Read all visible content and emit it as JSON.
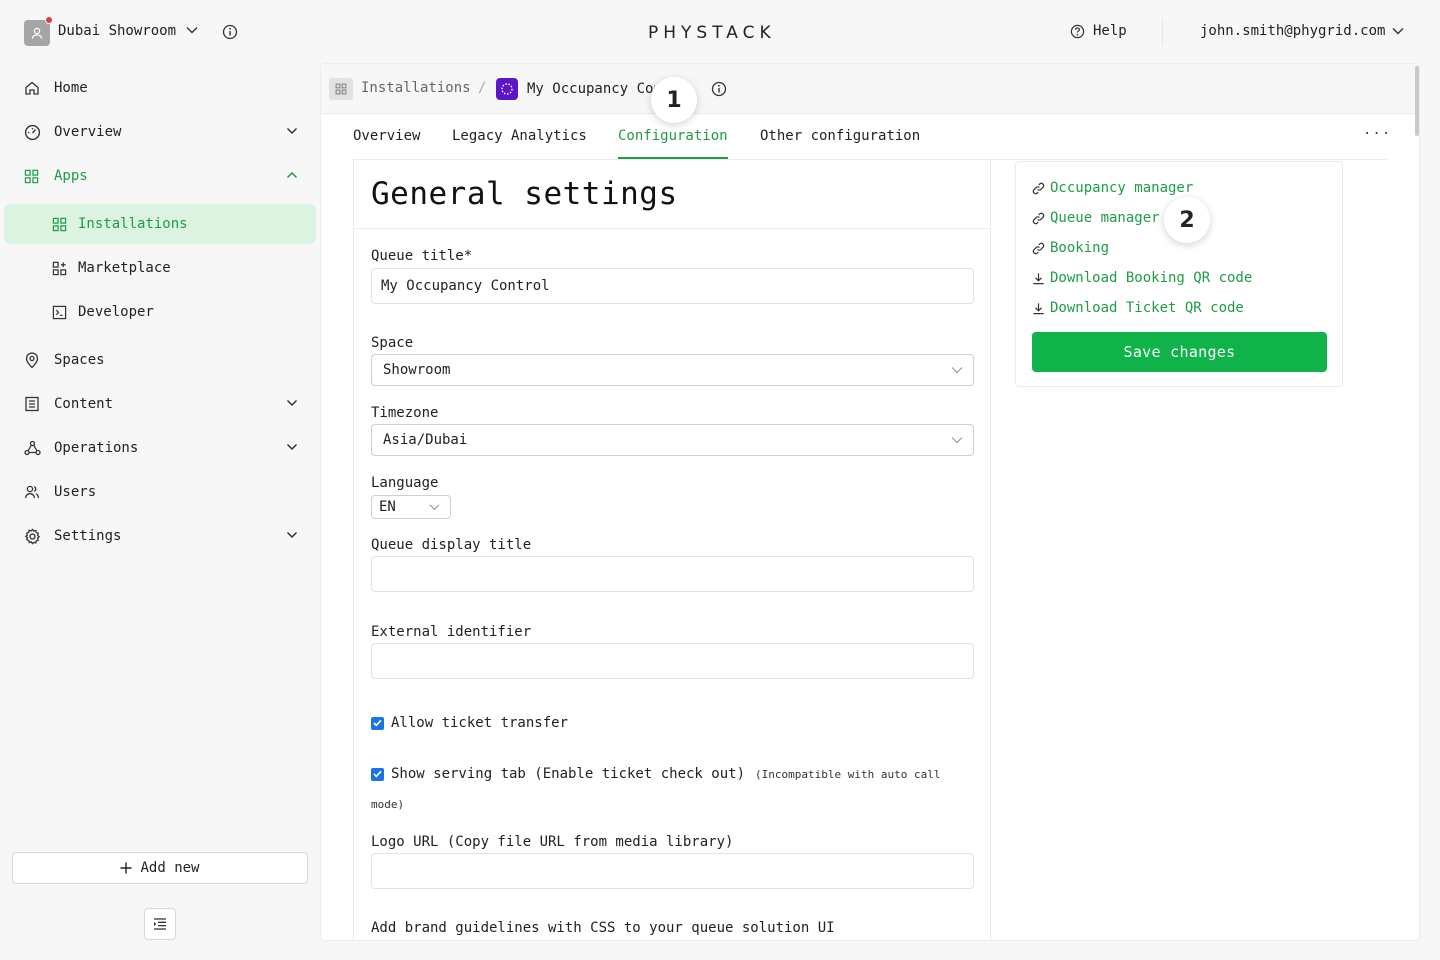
{
  "header": {
    "org_name": "Dubai Showroom",
    "brand": "PHYSTACK",
    "help_label": "Help",
    "user_email": "john.smith@phygrid.com"
  },
  "sidebar": {
    "items": [
      {
        "label": "Home",
        "icon": "home-icon"
      },
      {
        "label": "Overview",
        "icon": "gauge-icon"
      },
      {
        "label": "Apps",
        "icon": "grid-icon"
      },
      {
        "label": "Installations",
        "icon": "grid-icon"
      },
      {
        "label": "Marketplace",
        "icon": "grid-plus-icon"
      },
      {
        "label": "Developer",
        "icon": "terminal-icon"
      },
      {
        "label": "Spaces",
        "icon": "location-pin-icon"
      },
      {
        "label": "Content",
        "icon": "document-list-icon"
      },
      {
        "label": "Operations",
        "icon": "network-icon"
      },
      {
        "label": "Users",
        "icon": "users-icon"
      },
      {
        "label": "Settings",
        "icon": "gear-icon"
      }
    ],
    "add_new_label": "Add new"
  },
  "breadcrumb": {
    "root": "Installations",
    "separator": "/",
    "current": "My Occupancy Control"
  },
  "steps": {
    "one": "1",
    "two": "2"
  },
  "tabs": [
    {
      "label": "Overview"
    },
    {
      "label": "Legacy Analytics"
    },
    {
      "label": "Configuration",
      "active": true
    },
    {
      "label": "Other configuration"
    }
  ],
  "more_label": "···",
  "form": {
    "title": "General settings",
    "queue_title_label": "Queue title*",
    "queue_title_value": "My Occupancy Control",
    "space_label": "Space",
    "space_value": "Showroom",
    "timezone_label": "Timezone",
    "timezone_value": "Asia/Dubai",
    "language_label": "Language",
    "language_value": "EN",
    "display_title_label": "Queue display title",
    "display_title_value": "",
    "external_id_label": "External identifier",
    "external_id_value": "",
    "allow_transfer_label": "Allow ticket transfer",
    "allow_transfer_checked": true,
    "serving_tab_label": "Show serving tab (Enable ticket check out)",
    "serving_tab_note_1": "(Incompatible with auto call",
    "serving_tab_note_2": "mode)",
    "serving_tab_checked": true,
    "logo_url_label": "Logo URL (Copy file URL from media library)",
    "logo_url_value": "",
    "brand_css_label": "Add brand guidelines with CSS to your queue solution UI"
  },
  "side_links": [
    {
      "label": "Occupancy manager",
      "icon": "link-icon"
    },
    {
      "label": "Queue manager",
      "icon": "link-icon"
    },
    {
      "label": "Booking",
      "icon": "link-icon"
    },
    {
      "label": "Download Booking QR code",
      "icon": "download-icon"
    },
    {
      "label": "Download Ticket QR code",
      "icon": "download-icon"
    }
  ],
  "save_label": "Save changes",
  "colors": {
    "accent_green": "#1f9d45",
    "save_button": "#10b24a",
    "active_nav_bg": "#dcf3e2",
    "app_icon_purple": "#5d16c7",
    "notification_red": "#e53935",
    "checkbox_blue": "#1a73e8"
  }
}
